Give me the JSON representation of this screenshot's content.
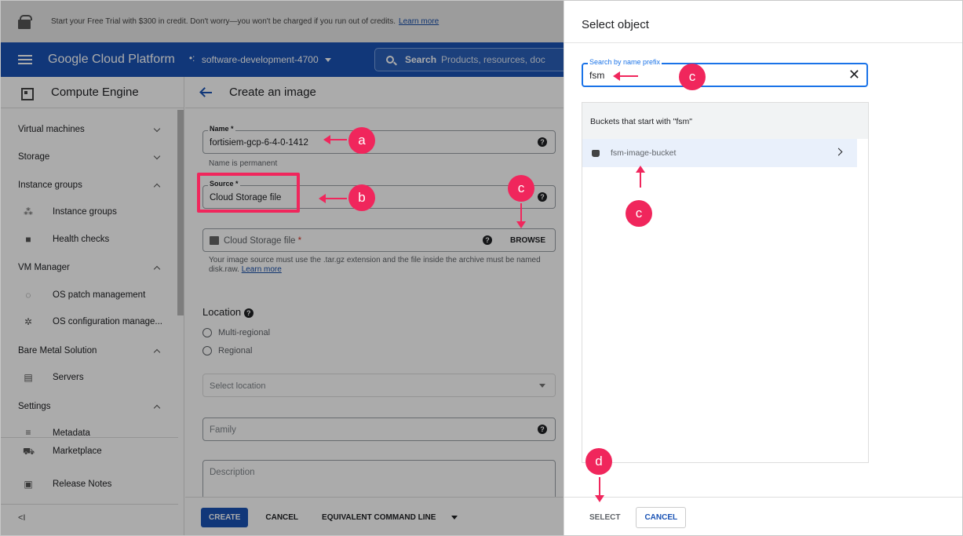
{
  "promo": {
    "text": "Start your Free Trial with $300 in credit. Don't worry—you won't be charged if you run out of credits.",
    "link": "Learn more"
  },
  "topbar": {
    "brand": "Google Cloud Platform",
    "project": "software-development-4700",
    "search_label": "Search",
    "search_placeholder": "Products, resources, doc"
  },
  "sidebar": {
    "title": "Compute Engine",
    "items": [
      {
        "label": "Virtual machines",
        "type": "section",
        "state": "collapsed"
      },
      {
        "label": "Storage",
        "type": "section",
        "state": "collapsed"
      },
      {
        "label": "Instance groups",
        "type": "section",
        "state": "expanded"
      },
      {
        "label": "Instance groups",
        "type": "sub",
        "icon": "instance-groups-icon"
      },
      {
        "label": "Health checks",
        "type": "sub",
        "icon": "health-checks-icon"
      },
      {
        "label": "VM Manager",
        "type": "section",
        "state": "expanded"
      },
      {
        "label": "OS patch management",
        "type": "sub",
        "icon": "os-patch-icon"
      },
      {
        "label": "OS configuration manage...",
        "type": "sub",
        "icon": "os-config-icon"
      },
      {
        "label": "Bare Metal Solution",
        "type": "section",
        "state": "expanded"
      },
      {
        "label": "Servers",
        "type": "sub",
        "icon": "servers-icon"
      },
      {
        "label": "Settings",
        "type": "section",
        "state": "expanded"
      },
      {
        "label": "Metadata",
        "type": "sub",
        "icon": "metadata-icon"
      },
      {
        "label": "Marketplace",
        "type": "footer",
        "icon": "marketplace-icon"
      },
      {
        "label": "Release Notes",
        "type": "footer",
        "icon": "release-notes-icon"
      }
    ],
    "collapse_label": "<I"
  },
  "main": {
    "title": "Create an image",
    "name_label": "Name *",
    "name_value": "fortisiem-gcp-6-4-0-1412",
    "name_hint": "Name is permanent",
    "source_label": "Source *",
    "source_value": "Cloud Storage file",
    "cs_label": "Cloud Storage file",
    "cs_required": "*",
    "browse_label": "BROWSE",
    "cs_hint": "Your image source must use the .tar.gz extension and the file inside the archive must be named disk.raw.",
    "cs_hint_link": "Learn more",
    "location_title": "Location",
    "location_options": [
      "Multi-regional",
      "Regional"
    ],
    "location_placeholder": "Select location",
    "family_placeholder": "Family",
    "description_placeholder": "Description",
    "footer": {
      "create": "CREATE",
      "cancel": "CANCEL",
      "equivalent": "EQUIVALENT COMMAND LINE"
    }
  },
  "drawer": {
    "title": "Select object",
    "search_label": "Search by name prefix",
    "search_value": "fsm",
    "list_header": "Buckets that start with \"fsm\"",
    "bucket_name": "fsm-image-bucket",
    "select_label": "SELECT",
    "cancel_label": "CANCEL"
  },
  "annotations": {
    "a": "a",
    "b": "b",
    "c": "c",
    "d": "d"
  },
  "colors": {
    "accent": "#1a53b5",
    "annotation": "#f0265c"
  }
}
